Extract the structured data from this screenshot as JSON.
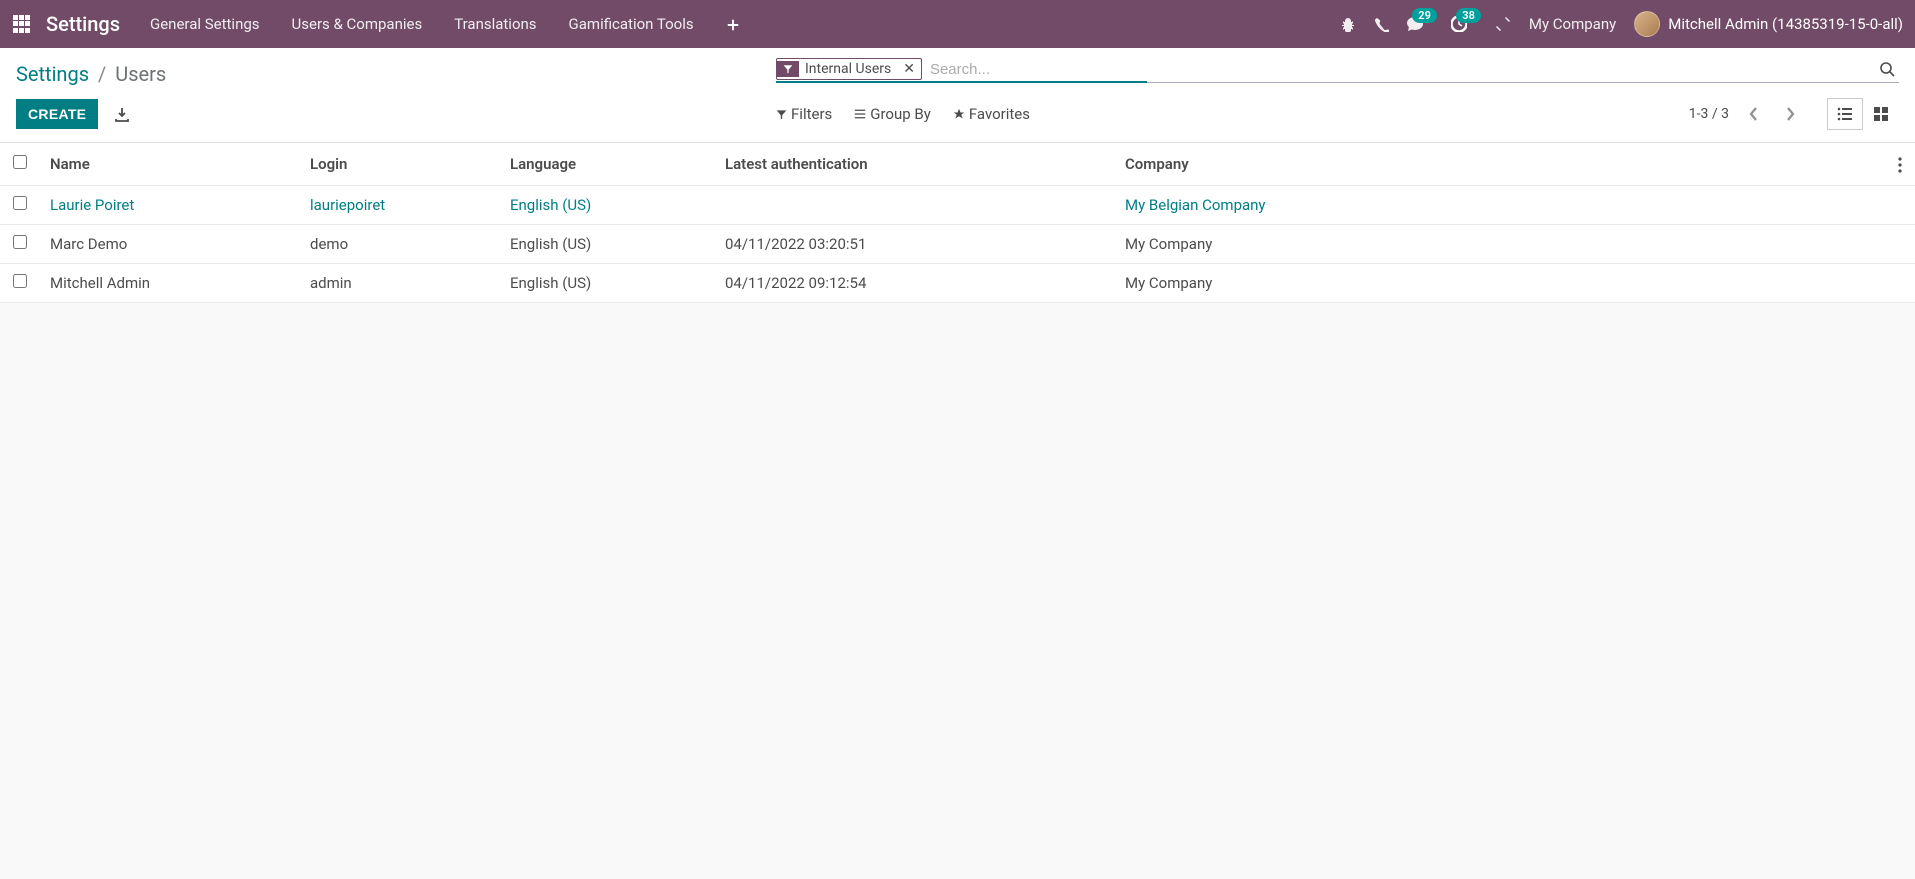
{
  "topnav": {
    "app_title": "Settings",
    "menu": [
      "General Settings",
      "Users & Companies",
      "Translations",
      "Gamification Tools"
    ],
    "messaging_badge": "29",
    "activity_badge": "38",
    "company": "My Company",
    "user": "Mitchell Admin (14385319-15-0-all)"
  },
  "breadcrumb": {
    "root": "Settings",
    "current": "Users"
  },
  "search": {
    "facet_label": "Internal Users",
    "placeholder": "Search...",
    "filters": "Filters",
    "group_by": "Group By",
    "favorites": "Favorites"
  },
  "buttons": {
    "create": "CREATE"
  },
  "pager": {
    "text": "1-3 / 3"
  },
  "table": {
    "headers": {
      "name": "Name",
      "login": "Login",
      "language": "Language",
      "latest_auth": "Latest authentication",
      "company": "Company"
    },
    "rows": [
      {
        "name": "Laurie Poiret",
        "login": "lauriepoiret",
        "language": "English (US)",
        "latest_auth": "",
        "company": "My Belgian Company"
      },
      {
        "name": "Marc Demo",
        "login": "demo",
        "language": "English (US)",
        "latest_auth": "04/11/2022 03:20:51",
        "company": "My Company"
      },
      {
        "name": "Mitchell Admin",
        "login": "admin",
        "language": "English (US)",
        "latest_auth": "04/11/2022 09:12:54",
        "company": "My Company"
      }
    ]
  }
}
